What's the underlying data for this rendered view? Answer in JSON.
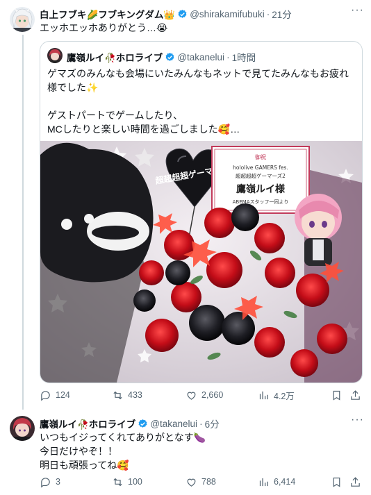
{
  "tweet1": {
    "name": "白上フブキ🌽フブキングダム👑",
    "handle": "@shirakamifubuki",
    "dot": "·",
    "time": "21分",
    "text": "エッホエッホありがとう…😭",
    "quote": {
      "name": "鷹嶺ルイ🥀ホロライブ",
      "handle": "@takanelui",
      "dot": "·",
      "time": "1時間",
      "text": "ゲマズのみんなも会場にいたみんなもネットで見てたみんなもお疲れ様でした✨\n\nゲストパートでゲームしたり、\nMCしたりと楽しい時間を過ごしました🥰…",
      "card": {
        "title": "御祝",
        "line1": "hololive GAMERS fes.",
        "line2": "超超超超ゲーマーズ2",
        "recipient": "鷹嶺ルイ様",
        "from": "ABEMAスタッフ一同より"
      },
      "balloon_text": "超超超超ゲーマーズ²"
    },
    "stats": {
      "replies": "124",
      "retweets": "433",
      "likes": "2,660",
      "views": "4.2万"
    }
  },
  "tweet2": {
    "name": "鷹嶺ルイ🥀ホロライブ",
    "handle": "@takanelui",
    "dot": "·",
    "time": "6分",
    "text": "いつもイジってくれてありがとなす🍆\n今日だけやぞ！！\n明日も頑張ってね🥰",
    "stats": {
      "replies": "3",
      "retweets": "100",
      "likes": "788",
      "views": "6,414"
    }
  },
  "colors": {
    "text": "#0f1419",
    "muted": "#536471",
    "verified": "#1d9bf0",
    "border": "#cfd9de"
  },
  "icons": [
    "reply-icon",
    "retweet-icon",
    "like-icon",
    "views-icon",
    "bookmark-icon",
    "share-icon",
    "verified-icon",
    "more-icon"
  ]
}
